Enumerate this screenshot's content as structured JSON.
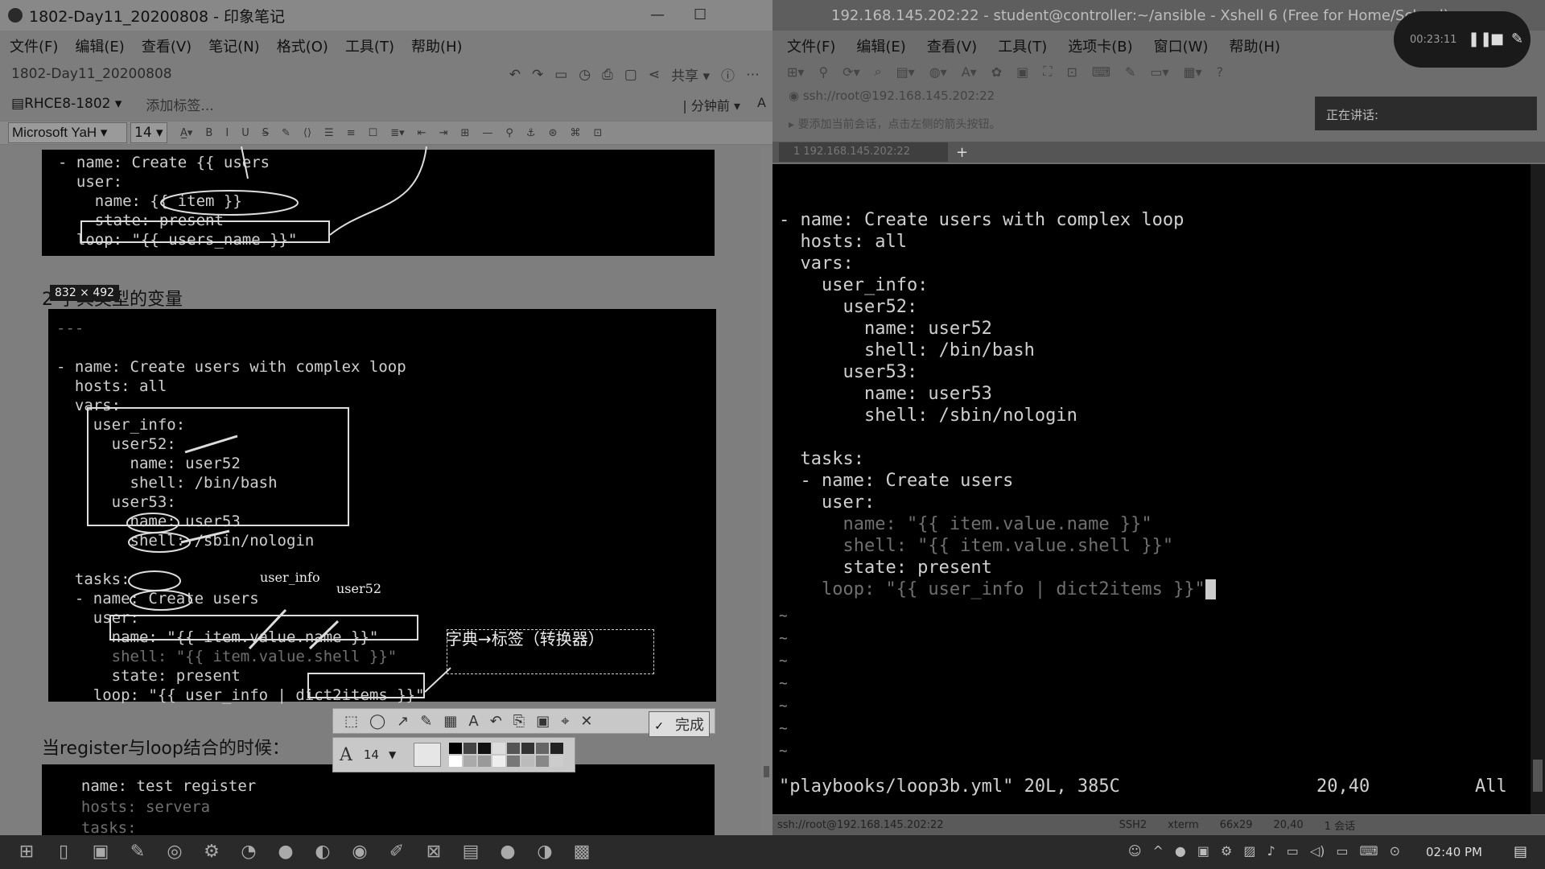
{
  "evernote": {
    "window_title": "1802-Day11_20200808 - 印象笔记",
    "menu": [
      "文件(F)",
      "编辑(E)",
      "查看(V)",
      "笔记(N)",
      "格式(O)",
      "工具(T)",
      "帮助(H)"
    ],
    "note_title": "1802-Day11_20200808",
    "share_label": "共享",
    "notebook": "RHCE8-1802",
    "add_tag": "添加标签...",
    "updated_label": "分钟前",
    "font_family_value": "Microsoft YaH",
    "font_size_value": "14",
    "code_block_1": [
      "- name: Create {{ users",
      "  user:",
      "    name: {{ item }}",
      "    state: present",
      "  loop: \"{{ users_name }}\""
    ],
    "size_badge": "832 × 492",
    "heading_dict_vars": "2 字典类型的变量",
    "code_block_2": {
      "line1": "---",
      "line2": "- name: Create users with complex loop",
      "line3": "  hosts: all",
      "line4": "  vars:",
      "line5": "    user_info:",
      "line6": "      user52:",
      "line7": "        name: user52",
      "line8": "        shell: /bin/bash",
      "line9": "      user53:",
      "line10": "        name: user53",
      "line11": "        shell: /sbin/nologin",
      "line12": "",
      "line13": "  tasks:",
      "line14": "  - name: Create users",
      "line15": "    user:",
      "line16": "      name: \"{{ item.value.name }}\"",
      "line17": "      shell: \"{{ item.value.shell }}\"",
      "line18": "      state: present",
      "line19": "    loop: \"{{ user_info | dict2items }}\""
    },
    "annot_user_info": "user_info",
    "annot_user52": "user52",
    "annot_dict": "字典→标签（转换器）",
    "heading_register_loop": "当register与loop结合的时候：",
    "code_block_3": [
      "  name: test register",
      "  hosts: servera",
      "  tasks:"
    ],
    "snip_done_label": "完成",
    "snip_font_size": "14"
  },
  "xshell": {
    "window_title": "192.168.145.202:22 - student@controller:~/ansible - Xshell 6 (Free for Home/School)",
    "menu": [
      "文件(F)",
      "编辑(E)",
      "查看(V)",
      "工具(T)",
      "选项卡(B)",
      "窗口(W)",
      "帮助(H)"
    ],
    "address": "ssh://root@192.168.145.202:22",
    "hint": "要添加当前会话，点击左侧的箭头按钮。",
    "tab_label": "1 192.168.145.202:22",
    "speaking_label": "正在讲话:",
    "recording_time": "00:23:11",
    "terminal_lines": [
      "- name: Create users with complex loop",
      "  hosts: all",
      "  vars:",
      "    user_info:",
      "      user52:",
      "        name: user52",
      "        shell: /bin/bash",
      "      user53:",
      "        name: user53",
      "        shell: /sbin/nologin",
      "",
      "  tasks:",
      "  - name: Create users",
      "    user:",
      "      name: \"{{ item.value.name }}\"",
      "      shell: \"{{ item.value.shell }}\"",
      "      state: present",
      "    loop: \"{{ user_info | dict2items }}\""
    ],
    "vim_file_info": "\"playbooks/loop3b.yml\" 20L, 385C",
    "vim_cursor_pos": "20,40",
    "vim_scroll": "All",
    "status": {
      "connection": "ssh://root@192.168.145.202:22",
      "protocol": "SSH2",
      "terminal": "xterm",
      "size": "66x29",
      "cursor": "20,40",
      "sessions": "1 会话"
    }
  },
  "taskbar": {
    "clock": "02:40 PM"
  }
}
